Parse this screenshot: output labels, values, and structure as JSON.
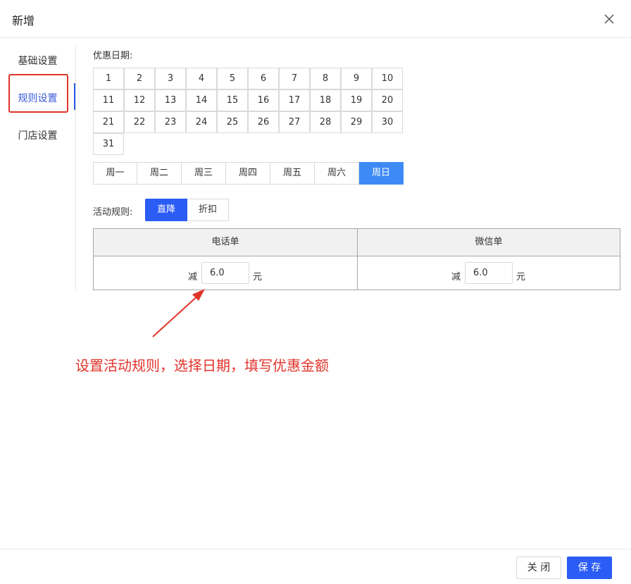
{
  "dialog": {
    "title": "新增"
  },
  "sidebar": {
    "items": [
      {
        "label": "基础设置"
      },
      {
        "label": "规则设置"
      },
      {
        "label": "门店设置"
      }
    ]
  },
  "dates": {
    "label": "优惠日期:",
    "days": [
      "1",
      "2",
      "3",
      "4",
      "5",
      "6",
      "7",
      "8",
      "9",
      "10",
      "11",
      "12",
      "13",
      "14",
      "15",
      "16",
      "17",
      "18",
      "19",
      "20",
      "21",
      "22",
      "23",
      "24",
      "25",
      "26",
      "27",
      "28",
      "29",
      "30",
      "31"
    ],
    "weekdays": [
      "周一",
      "周二",
      "周三",
      "周四",
      "周五",
      "周六",
      "周日"
    ],
    "selected_weekday": "周日"
  },
  "rule": {
    "label": "活动规则:",
    "options": [
      "直降",
      "折扣"
    ],
    "selected": "直降"
  },
  "table": {
    "columns": [
      {
        "header": "电话单",
        "prefix": "减",
        "value": "6.0",
        "suffix": "元"
      },
      {
        "header": "微信单",
        "prefix": "减",
        "value": "6.0",
        "suffix": "元"
      }
    ]
  },
  "annotation": {
    "text": "设置活动规则，选择日期，填写优惠金额"
  },
  "footer": {
    "close_label": "关 闭",
    "save_label": "保 存"
  },
  "colors": {
    "primary": "#2b5cf6",
    "weekday_selected": "#3d8af7",
    "annotation": "#e0332a"
  }
}
